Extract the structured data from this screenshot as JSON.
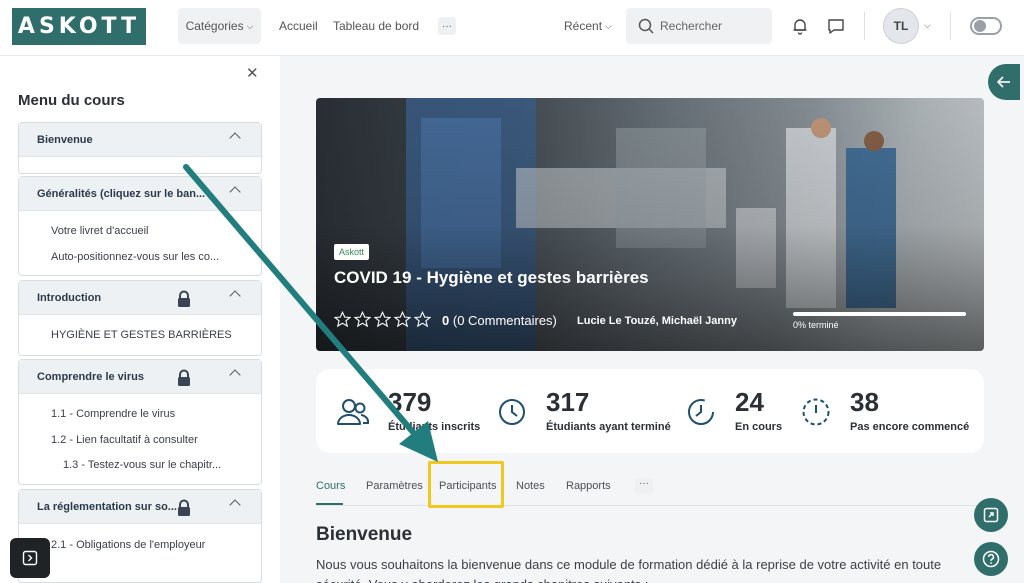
{
  "header": {
    "logo": "ASKOTT",
    "nav": {
      "categories": "Catégories",
      "accueil": "Accueil",
      "tableau_de_bord": "Tableau de bord",
      "more": "···",
      "recent": "Récent"
    },
    "search_placeholder": "Rechercher",
    "avatar_initials": "TL"
  },
  "sidebar": {
    "title": "Menu du cours",
    "sections": [
      {
        "title": "Bienvenue",
        "locked": false,
        "items": []
      },
      {
        "title": "Généralités (cliquez sur le ban...",
        "locked": false,
        "items": [
          "Votre livret d'accueil",
          "Auto-positionnez-vous sur les co..."
        ]
      },
      {
        "title": "Introduction",
        "locked": true,
        "items": [
          "HYGIÈNE ET GESTES BARRIÈRES"
        ]
      },
      {
        "title": "Comprendre le virus",
        "locked": true,
        "items": [
          "1.1 - Comprendre le virus",
          "1.2 - Lien facultatif à consulter",
          "1.3 - Testez-vous sur le chapitr..."
        ]
      },
      {
        "title": "La réglementation sur so...",
        "locked": true,
        "items": [
          "2.1 - Obligations de l'employeur"
        ]
      }
    ]
  },
  "course": {
    "badge": "Askott",
    "title": "COVID 19 - Hygiène et gestes barrières",
    "rating_value": "0",
    "rating_comments": "(0 Commentaires)",
    "authors": "Lucie Le Touzé, Michaël Janny",
    "progress_percent": 0,
    "progress_label": "0% terminé"
  },
  "stats": [
    {
      "value": "379",
      "label": "Étudiants inscrits"
    },
    {
      "value": "317",
      "label": "Étudiants ayant terminé"
    },
    {
      "value": "24",
      "label": "En cours"
    },
    {
      "value": "38",
      "label": "Pas encore commencé"
    }
  ],
  "tabs": [
    "Cours",
    "Paramètres",
    "Participants",
    "Notes",
    "Rapports"
  ],
  "tabs_more": "···",
  "content": {
    "heading": "Bienvenue",
    "paragraph": "Nous vous souhaitons la bienvenue dans ce module de formation dédié à la reprise de votre activité en toute sécurité. Vous y aborderez les grands chapitres suivants :"
  },
  "colors": {
    "brand": "#2f6e6a",
    "highlight": "#f2c81e"
  }
}
